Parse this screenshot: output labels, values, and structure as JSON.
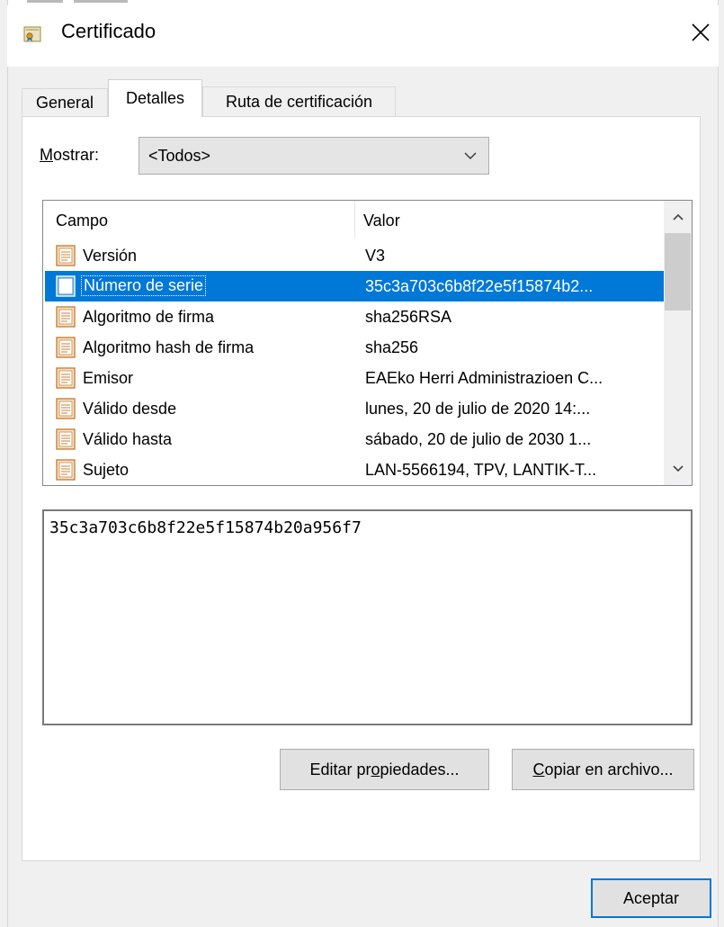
{
  "window": {
    "title": "Certificado",
    "close_glyph": "✕"
  },
  "tabs": [
    {
      "label": "General",
      "active": false
    },
    {
      "label": "Detalles",
      "active": true
    },
    {
      "label": "Ruta de certificación",
      "active": false
    }
  ],
  "mostrar": {
    "label_underlined": "M",
    "label_rest": "ostrar:",
    "selected": "<Todos>"
  },
  "list": {
    "columns": {
      "campo": "Campo",
      "valor": "Valor"
    },
    "rows": [
      {
        "campo": "Versión",
        "valor": "V3"
      },
      {
        "campo": "Número de serie",
        "valor": "35c3a703c6b8f22e5f15874b2..."
      },
      {
        "campo": "Algoritmo de firma",
        "valor": "sha256RSA"
      },
      {
        "campo": "Algoritmo hash de firma",
        "valor": "sha256"
      },
      {
        "campo": "Emisor",
        "valor": "EAEko Herri Administrazioen C..."
      },
      {
        "campo": "Válido desde",
        "valor": "lunes, 20 de julio de 2020 14:..."
      },
      {
        "campo": "Válido hasta",
        "valor": "sábado, 20 de julio de 2030 1..."
      },
      {
        "campo": "Sujeto",
        "valor": "LAN-5566194, TPV, LANTIK-T..."
      }
    ],
    "selected_index": 1
  },
  "detail": {
    "value": "35c3a703c6b8f22e5f15874b20a956f7"
  },
  "buttons": {
    "editar_pre": "Editar pr",
    "editar_u": "o",
    "editar_post": "piedades...",
    "copiar_u": "C",
    "copiar_post": "opiar en archivo...",
    "aceptar": "Aceptar"
  },
  "colors": {
    "selection": "#0078d7",
    "icon_border": "#c8813a",
    "icon_fill": "#f6e3c6"
  }
}
